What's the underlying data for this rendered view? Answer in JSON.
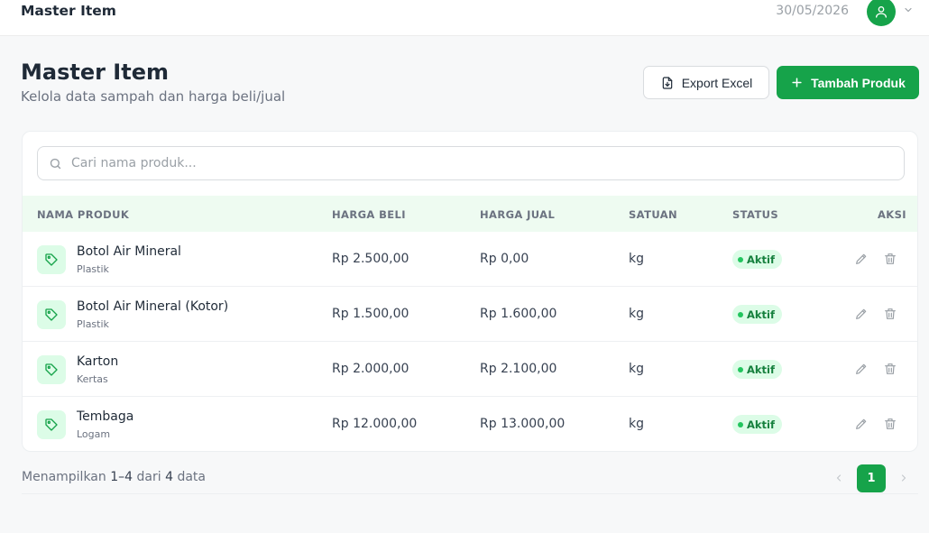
{
  "header": {
    "app_title": "Master Item",
    "date": "30/05/2026"
  },
  "page": {
    "title": "Master Item",
    "subtitle": "Kelola data sampah dan harga beli/jual"
  },
  "actions": {
    "export_label": "Export Excel",
    "add_label": "Tambah Produk"
  },
  "search": {
    "placeholder": "Cari nama produk..."
  },
  "table": {
    "headers": {
      "name": "NAMA PRODUK",
      "buy": "HARGA BELI",
      "sell": "HARGA JUAL",
      "unit": "SATUAN",
      "status": "STATUS",
      "action": "AKSI"
    },
    "rows": [
      {
        "name": "Botol Air Mineral",
        "category": "Plastik",
        "buy": "Rp 2.500,00",
        "sell": "Rp 0,00",
        "unit": "kg",
        "status": "Aktif"
      },
      {
        "name": "Botol Air Mineral (Kotor)",
        "category": "Plastik",
        "buy": "Rp 1.500,00",
        "sell": "Rp 1.600,00",
        "unit": "kg",
        "status": "Aktif"
      },
      {
        "name": "Karton",
        "category": "Kertas",
        "buy": "Rp 2.000,00",
        "sell": "Rp 2.100,00",
        "unit": "kg",
        "status": "Aktif"
      },
      {
        "name": "Tembaga",
        "category": "Logam",
        "buy": "Rp 12.000,00",
        "sell": "Rp 13.000,00",
        "unit": "kg",
        "status": "Aktif"
      }
    ]
  },
  "footer": {
    "prefix": "Menampilkan",
    "range": "1–4",
    "middle": "dari",
    "total": "4",
    "suffix": "data",
    "current_page": "1"
  },
  "colors": {
    "accent": "#16a34a",
    "badge_bg": "#dcfce7",
    "header_bg": "#eefbf1"
  }
}
